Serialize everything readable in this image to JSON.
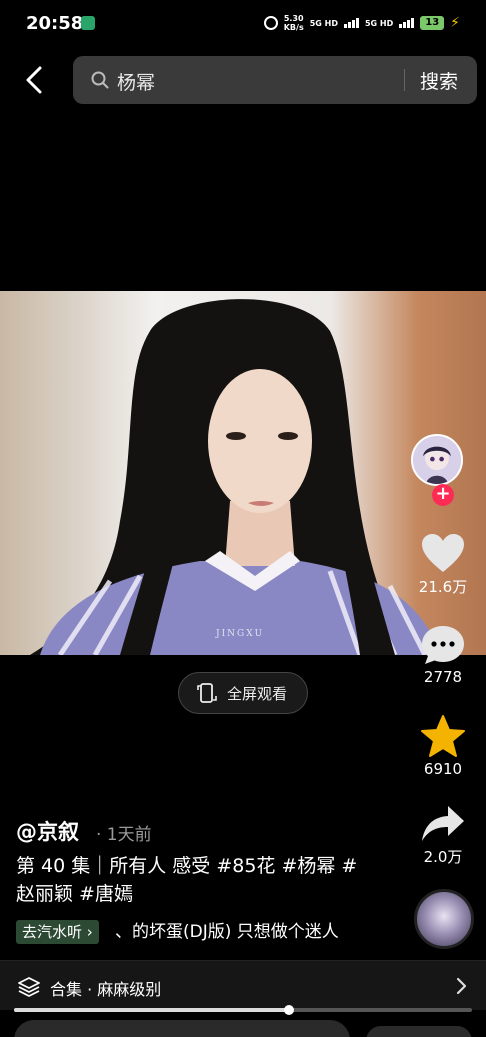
{
  "status_bar": {
    "time": "20:58",
    "net_speed_value": "5.30",
    "net_speed_unit": "KB/s",
    "signal_1": "5G HD",
    "signal_2": "5G HD",
    "battery": "13"
  },
  "search": {
    "query": "杨幂",
    "button_label": "搜索"
  },
  "video": {
    "watermark": "JINGXU",
    "fullscreen_label": "全屏观看"
  },
  "actions": {
    "likes": "21.6万",
    "comments": "2778",
    "favorites": "6910",
    "shares": "2.0万",
    "like_color": "#e6e6e6",
    "favorite_color": "#f5b301",
    "follow_color": "#fe2c55"
  },
  "post": {
    "author": "@京叙",
    "time_ago": "· 1天前",
    "caption_line1": "第 40 集｜所有人 感受 #85花 #杨幂 #",
    "caption_line2": "赵丽颖 #唐嫣",
    "music_tag": "去汽水听 ›",
    "music_title": "、的坏蛋(DJ版)    只想做个迷人"
  },
  "collection": {
    "label": "合集 · 麻麻级别"
  },
  "progress": {
    "fraction": 0.6
  }
}
